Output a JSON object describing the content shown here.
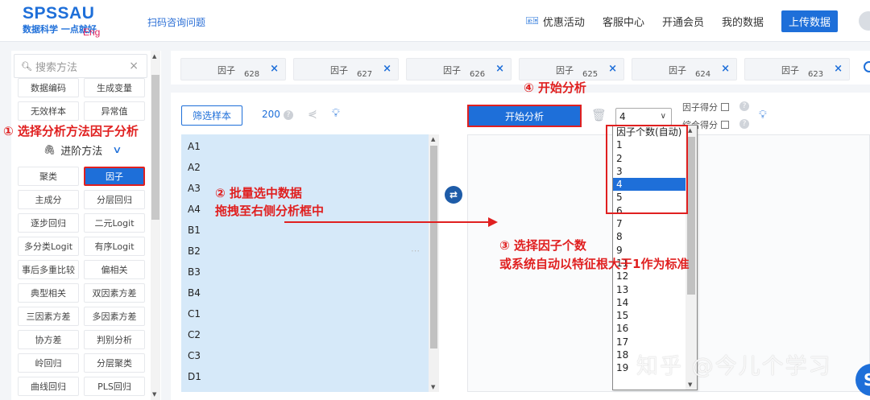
{
  "header": {
    "logo_title": "SPSSAU",
    "logo_sub": "数据科学 一点就好",
    "logo_eng": "Eng",
    "consult_link": "扫码咨询问题",
    "nav": {
      "promo": "优惠活动",
      "service": "客服中心",
      "member": "开通会员",
      "my_data": "我的数据",
      "upload": "上传数据"
    }
  },
  "sidebar": {
    "search_placeholder": "搜索方法",
    "top_methods": [
      "数据编码",
      "生成变量",
      "无效样本",
      "异常值"
    ],
    "advanced_label": "进阶方法",
    "methods": [
      "聚类",
      "因子",
      "主成分",
      "分层回归",
      "逐步回归",
      "二元Logit",
      "多分类Logit",
      "有序Logit",
      "事后多重比较",
      "偏相关",
      "典型相关",
      "双因素方差",
      "三因素方差",
      "多因素方差",
      "协方差",
      "判别分析",
      "岭回归",
      "分层聚类",
      "曲线回归",
      "PLS回归"
    ],
    "active_method": "因子"
  },
  "tabs": [
    {
      "label": "因子",
      "num": "628"
    },
    {
      "label": "因子",
      "num": "627"
    },
    {
      "label": "因子",
      "num": "626"
    },
    {
      "label": "因子",
      "num": "625"
    },
    {
      "label": "因子",
      "num": "624"
    },
    {
      "label": "因子",
      "num": "623"
    }
  ],
  "toolbar": {
    "filter_label": "筛选样本",
    "sample_count": "200",
    "start_label": "开始分析",
    "factor_count_value": "4",
    "factor_score_label": "因子得分",
    "composite_score_label": "综合得分"
  },
  "variables": [
    "A1",
    "A2",
    "A3",
    "A4",
    "B1",
    "B2",
    "B3",
    "B4",
    "C1",
    "C2",
    "C3",
    "D1"
  ],
  "factor_dropdown": {
    "options": [
      "因子个数(自动)",
      "1",
      "2",
      "3",
      "4",
      "5",
      "6",
      "7",
      "8",
      "9",
      "11",
      "12",
      "13",
      "14",
      "15",
      "16",
      "17",
      "18",
      "19"
    ],
    "selected": "4"
  },
  "annotations": {
    "step1": "① 选择分析方法因子分析",
    "step2_line1": "② 批量选中数据",
    "step2_line2": "拖拽至右侧分析框中",
    "step3_line1": "③ 选择因子个数",
    "step3_line2": "或系统自动以特征根大于1作为标准",
    "step4": "④ 开始分析"
  },
  "watermark": "知乎 @今儿个学习",
  "colors": {
    "brand": "#1e6fd9",
    "annotation": "#e02020",
    "var_list_bg": "#d6e9f9"
  }
}
